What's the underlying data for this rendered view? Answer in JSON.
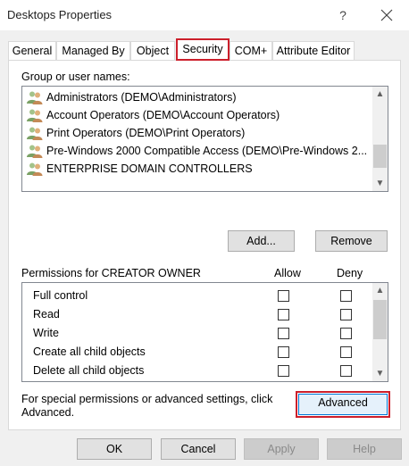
{
  "window": {
    "title": "Desktops Properties",
    "help_glyph": "?"
  },
  "tabs": [
    {
      "label": "General"
    },
    {
      "label": "Managed By"
    },
    {
      "label": "Object"
    },
    {
      "label": "Security",
      "active": true
    },
    {
      "label": "COM+"
    },
    {
      "label": "Attribute Editor"
    }
  ],
  "security": {
    "groups_label": "Group or user names:",
    "groups": [
      "Administrators (DEMO\\Administrators)",
      "Account Operators (DEMO\\Account Operators)",
      "Print Operators (DEMO\\Print Operators)",
      "Pre-Windows 2000 Compatible Access (DEMO\\Pre-Windows 2...",
      "ENTERPRISE DOMAIN CONTROLLERS"
    ],
    "add_label": "Add...",
    "remove_label": "Remove",
    "permissions_label": "Permissions for CREATOR OWNER",
    "allow_header": "Allow",
    "deny_header": "Deny",
    "permissions": [
      {
        "name": "Full control",
        "allow": false,
        "deny": false
      },
      {
        "name": "Read",
        "allow": false,
        "deny": false
      },
      {
        "name": "Write",
        "allow": false,
        "deny": false
      },
      {
        "name": "Create all child objects",
        "allow": false,
        "deny": false
      },
      {
        "name": "Delete all child objects",
        "allow": false,
        "deny": false
      }
    ],
    "special_text_line1": "For special permissions or advanced settings, click",
    "special_text_line2": "Advanced.",
    "advanced_label": "Advanced"
  },
  "footer": {
    "ok_label": "OK",
    "cancel_label": "Cancel",
    "apply_label": "Apply",
    "help_label": "Help"
  },
  "colors": {
    "highlight": "#cc1f2b",
    "dialog_bg": "#f0f0f0",
    "button_bg": "#e1e1e1"
  }
}
